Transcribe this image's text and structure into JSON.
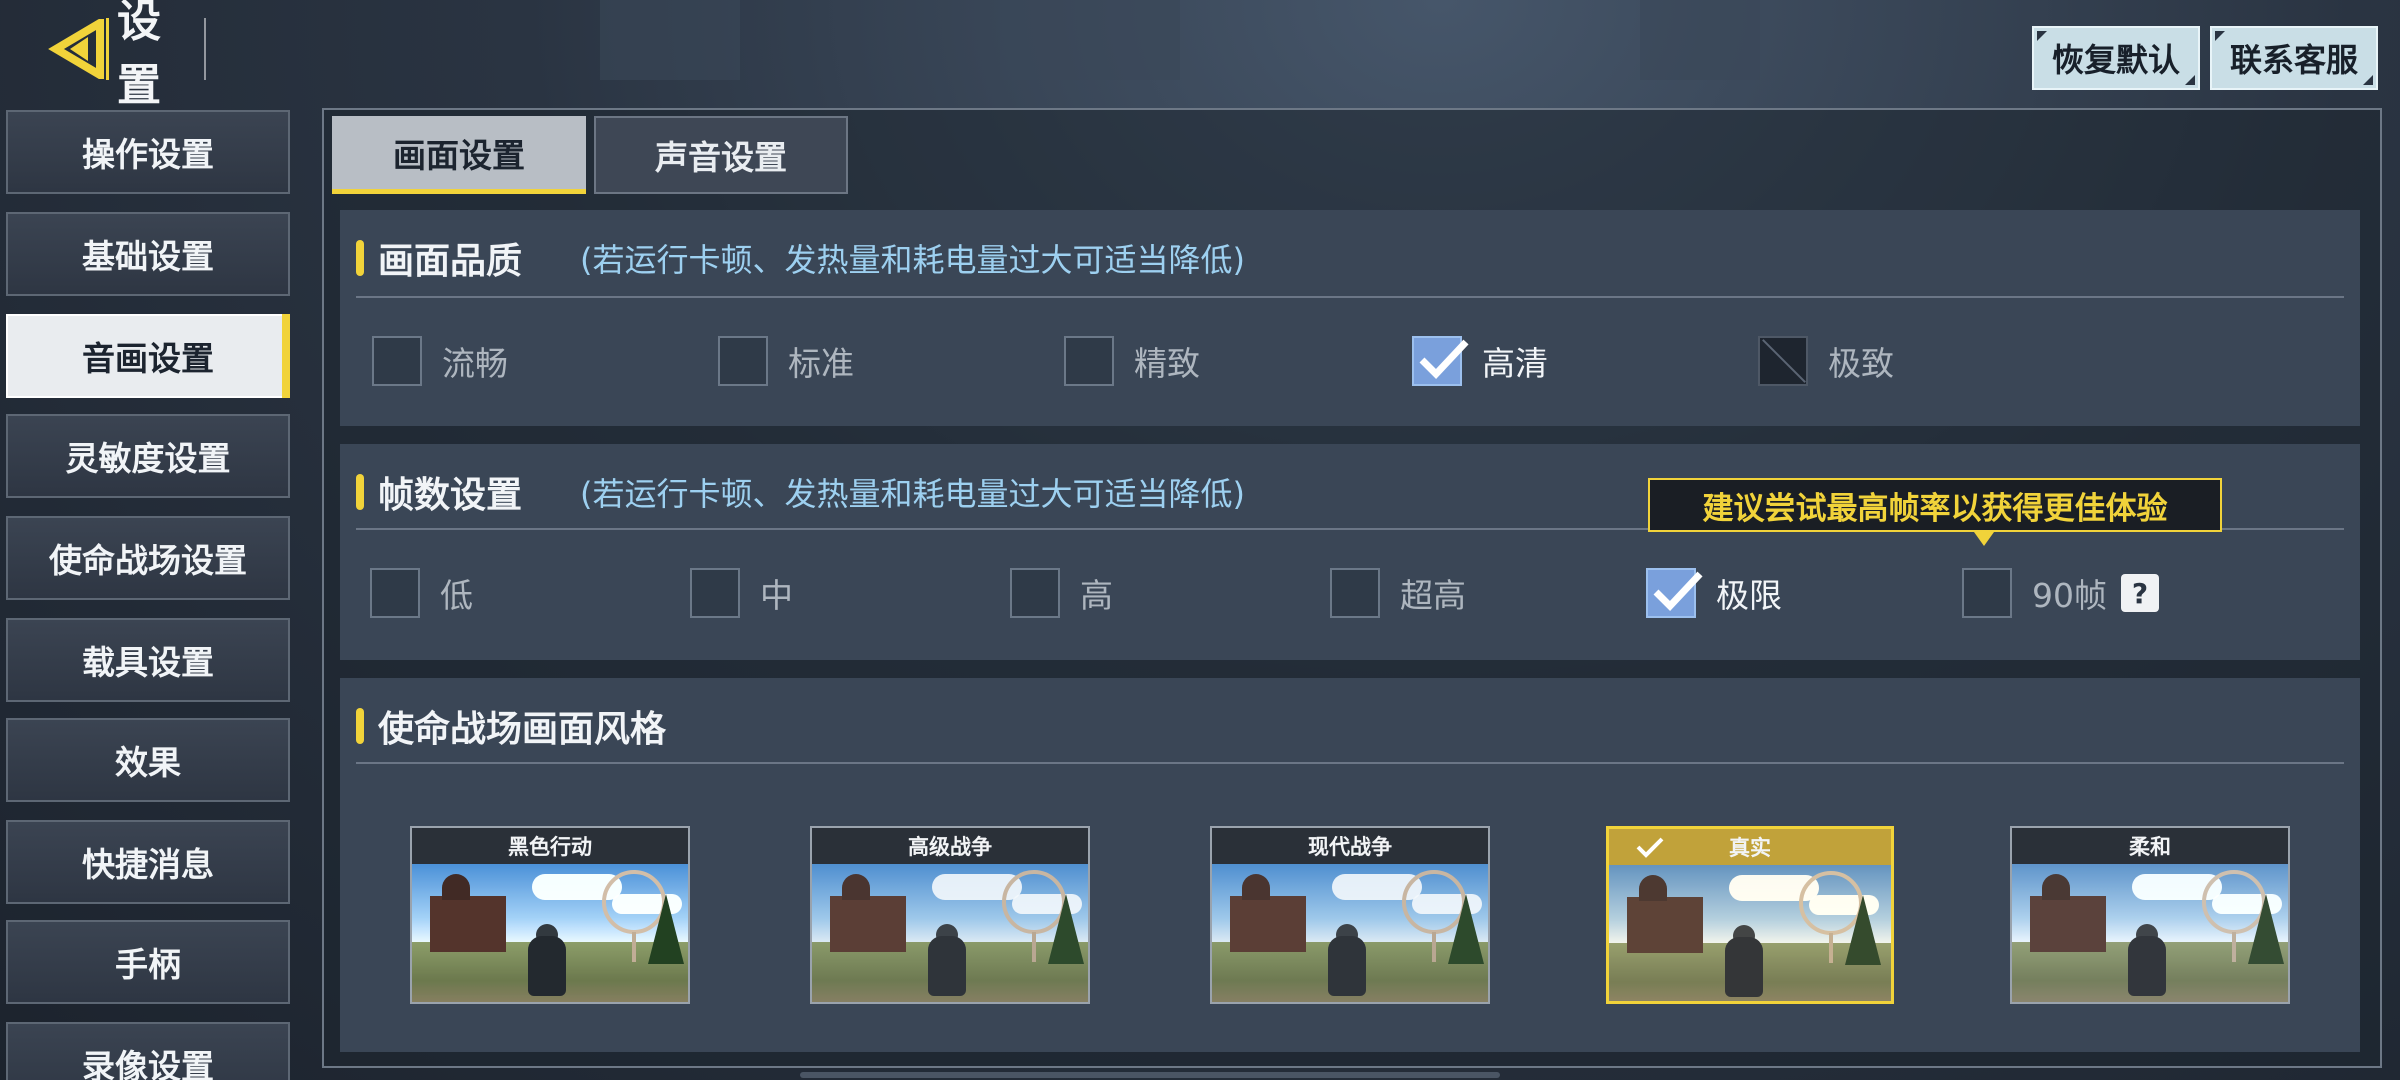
{
  "header": {
    "title": "设置",
    "restore_default": "恢复默认",
    "contact_support": "联系客服",
    "accent_color": "#f1d33a"
  },
  "sidebar": {
    "items": [
      {
        "label": "操作设置",
        "active": false
      },
      {
        "label": "基础设置",
        "active": false
      },
      {
        "label": "音画设置",
        "active": true
      },
      {
        "label": "灵敏度设置",
        "active": false
      },
      {
        "label": "使命战场设置",
        "active": false
      },
      {
        "label": "载具设置",
        "active": false
      },
      {
        "label": "效果",
        "active": false
      },
      {
        "label": "快捷消息",
        "active": false
      },
      {
        "label": "手柄",
        "active": false
      },
      {
        "label": "录像设置",
        "active": false
      }
    ]
  },
  "tabs": [
    {
      "label": "画面设置",
      "active": true
    },
    {
      "label": "声音设置",
      "active": false
    }
  ],
  "quality": {
    "title": "画面品质",
    "note": "(若运行卡顿、发热量和耗电量过大可适当降低)",
    "options": [
      {
        "label": "流畅",
        "state": "unchecked"
      },
      {
        "label": "标准",
        "state": "unchecked"
      },
      {
        "label": "精致",
        "state": "unchecked"
      },
      {
        "label": "高清",
        "state": "checked"
      },
      {
        "label": "极致",
        "state": "disabled"
      }
    ]
  },
  "framerate": {
    "title": "帧数设置",
    "note": "(若运行卡顿、发热量和耗电量过大可适当降低)",
    "tooltip": "建议尝试最高帧率以获得更佳体验",
    "help_icon": "?",
    "options": [
      {
        "label": "低",
        "state": "unchecked"
      },
      {
        "label": "中",
        "state": "unchecked"
      },
      {
        "label": "高",
        "state": "unchecked"
      },
      {
        "label": "超高",
        "state": "unchecked"
      },
      {
        "label": "极限",
        "state": "checked"
      },
      {
        "label": "90帧",
        "state": "unchecked"
      }
    ]
  },
  "style": {
    "title": "使命战场画面风格",
    "cards": [
      {
        "label": "黑色行动",
        "selected": false
      },
      {
        "label": "高级战争",
        "selected": false
      },
      {
        "label": "现代战争",
        "selected": false
      },
      {
        "label": "真实",
        "selected": true
      },
      {
        "label": "柔和",
        "selected": false
      }
    ]
  }
}
